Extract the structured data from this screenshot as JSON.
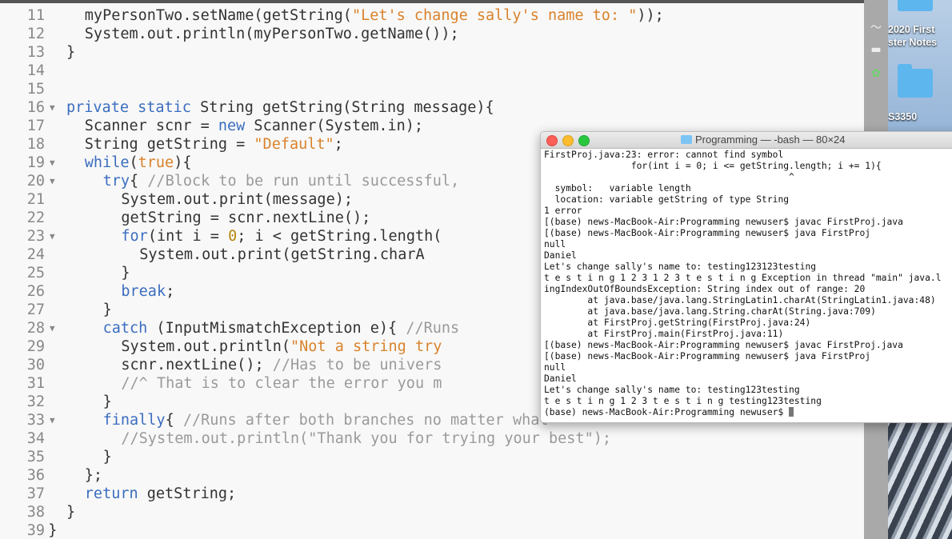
{
  "editor": {
    "lines": [
      {
        "n": "11",
        "fold": "",
        "indent": 4,
        "tokens": [
          [
            "plain",
            "myPersonTwo.setName(getString("
          ],
          [
            "str",
            "\"Let's change sally's name to: \""
          ],
          [
            "plain",
            "));"
          ]
        ]
      },
      {
        "n": "12",
        "fold": "",
        "indent": 4,
        "tokens": [
          [
            "plain",
            "System.out.println(myPersonTwo.getName());"
          ]
        ]
      },
      {
        "n": "13",
        "fold": "",
        "indent": 2,
        "tokens": [
          [
            "plain",
            "}"
          ]
        ]
      },
      {
        "n": "14",
        "fold": "",
        "indent": 0,
        "tokens": []
      },
      {
        "n": "15",
        "fold": "",
        "indent": 0,
        "tokens": []
      },
      {
        "n": "16",
        "fold": "▼",
        "indent": 2,
        "tokens": [
          [
            "kw",
            "private static "
          ],
          [
            "plain",
            "String getString(String message){"
          ]
        ]
      },
      {
        "n": "17",
        "fold": "",
        "indent": 4,
        "tokens": [
          [
            "plain",
            "Scanner scnr = "
          ],
          [
            "kw",
            "new"
          ],
          [
            "plain",
            " Scanner(System.in);"
          ]
        ]
      },
      {
        "n": "18",
        "fold": "",
        "indent": 4,
        "tokens": [
          [
            "plain",
            "String getString = "
          ],
          [
            "str",
            "\"Default\""
          ],
          [
            "plain",
            ";"
          ]
        ]
      },
      {
        "n": "19",
        "fold": "▼",
        "indent": 4,
        "tokens": [
          [
            "kw",
            "while"
          ],
          [
            "plain",
            "("
          ],
          [
            "str",
            "true"
          ],
          [
            "plain",
            "){"
          ]
        ]
      },
      {
        "n": "20",
        "fold": "▼",
        "indent": 6,
        "tokens": [
          [
            "kw",
            "try"
          ],
          [
            "plain",
            "{ "
          ],
          [
            "com",
            "//Block to be run until successful, "
          ]
        ]
      },
      {
        "n": "21",
        "fold": "",
        "indent": 8,
        "tokens": [
          [
            "plain",
            "System.out.print(message);"
          ]
        ]
      },
      {
        "n": "22",
        "fold": "",
        "indent": 8,
        "tokens": [
          [
            "plain",
            "getString = scnr.nextLine();"
          ]
        ]
      },
      {
        "n": "23",
        "fold": "▼",
        "indent": 8,
        "tokens": [
          [
            "kw",
            "for"
          ],
          [
            "plain",
            "(int i = "
          ],
          [
            "num",
            "0"
          ],
          [
            "plain",
            "; i < getString.length("
          ]
        ]
      },
      {
        "n": "24",
        "fold": "",
        "indent": 10,
        "tokens": [
          [
            "plain",
            "System.out.print(getString.charA"
          ]
        ]
      },
      {
        "n": "25",
        "fold": "",
        "indent": 8,
        "tokens": [
          [
            "plain",
            "}"
          ]
        ]
      },
      {
        "n": "26",
        "fold": "",
        "indent": 8,
        "tokens": [
          [
            "kw",
            "break"
          ],
          [
            "plain",
            ";"
          ]
        ]
      },
      {
        "n": "27",
        "fold": "",
        "indent": 6,
        "tokens": [
          [
            "plain",
            "}"
          ]
        ]
      },
      {
        "n": "28",
        "fold": "▼",
        "indent": 6,
        "tokens": [
          [
            "kw",
            "catch"
          ],
          [
            "plain",
            " (InputMismatchException e){ "
          ],
          [
            "com",
            "//Runs"
          ]
        ]
      },
      {
        "n": "29",
        "fold": "",
        "indent": 8,
        "tokens": [
          [
            "plain",
            "System.out.println("
          ],
          [
            "str",
            "\"Not a string try"
          ]
        ]
      },
      {
        "n": "30",
        "fold": "",
        "indent": 8,
        "tokens": [
          [
            "plain",
            "scnr.nextLine(); "
          ],
          [
            "com",
            "//Has to be univers"
          ]
        ]
      },
      {
        "n": "31",
        "fold": "",
        "indent": 8,
        "tokens": [
          [
            "com",
            "//^ That is to clear the error you m"
          ]
        ]
      },
      {
        "n": "32",
        "fold": "",
        "indent": 6,
        "tokens": [
          [
            "plain",
            "}"
          ]
        ]
      },
      {
        "n": "33",
        "fold": "▼",
        "indent": 6,
        "tokens": [
          [
            "kw",
            "finally"
          ],
          [
            "plain",
            "{ "
          ],
          [
            "com",
            "//Runs after both branches no matter what"
          ]
        ]
      },
      {
        "n": "34",
        "fold": "",
        "indent": 8,
        "tokens": [
          [
            "com",
            "//System.out.println(\"Thank you for trying your best\");"
          ]
        ]
      },
      {
        "n": "35",
        "fold": "",
        "indent": 6,
        "tokens": [
          [
            "plain",
            "}"
          ]
        ]
      },
      {
        "n": "36",
        "fold": "",
        "indent": 4,
        "tokens": [
          [
            "plain",
            "};"
          ]
        ]
      },
      {
        "n": "37",
        "fold": "",
        "indent": 4,
        "tokens": [
          [
            "kw",
            "return"
          ],
          [
            "plain",
            " getString;"
          ]
        ]
      },
      {
        "n": "38",
        "fold": "",
        "indent": 2,
        "tokens": [
          [
            "plain",
            "}"
          ]
        ]
      },
      {
        "n": "39",
        "fold": "",
        "indent": 0,
        "tokens": [
          [
            "plain",
            "}"
          ]
        ]
      }
    ]
  },
  "desktop": {
    "item1_label": "2020 First",
    "item1_label2": "ster Notes",
    "item2_label": "S3350"
  },
  "terminal": {
    "title": "Programming — -bash — 80×24",
    "lines": [
      "FirstProj.java:23: error: cannot find symbol",
      "                for(int i = 0; i <= getString.length; i += 1){",
      "                                             ^",
      "  symbol:   variable length",
      "  location: variable getString of type String",
      "1 error",
      "[(base) news-MacBook-Air:Programming newuser$ javac FirstProj.java",
      "[(base) news-MacBook-Air:Programming newuser$ java FirstProj",
      "null",
      "Daniel",
      "Let's change sally's name to: testing123123testing",
      "t e s t i n g 1 2 3 1 2 3 t e s t i n g Exception in thread \"main\" java.l",
      "ingIndexOutOfBoundsException: String index out of range: 20",
      "        at java.base/java.lang.StringLatin1.charAt(StringLatin1.java:48)",
      "        at java.base/java.lang.String.charAt(String.java:709)",
      "        at FirstProj.getString(FirstProj.java:24)",
      "        at FirstProj.main(FirstProj.java:11)",
      "[(base) news-MacBook-Air:Programming newuser$ javac FirstProj.java",
      "[(base) news-MacBook-Air:Programming newuser$ java FirstProj",
      "null",
      "Daniel",
      "Let's change sally's name to: testing123testing",
      "t e s t i n g 1 2 3 t e s t i n g testing123testing"
    ],
    "prompt": "(base) news-MacBook-Air:Programming newuser$ "
  },
  "colors": {
    "keyword": "#3b6dbf",
    "string": "#d9822b",
    "number": "#b8860b",
    "comment": "#9a9a9a"
  }
}
